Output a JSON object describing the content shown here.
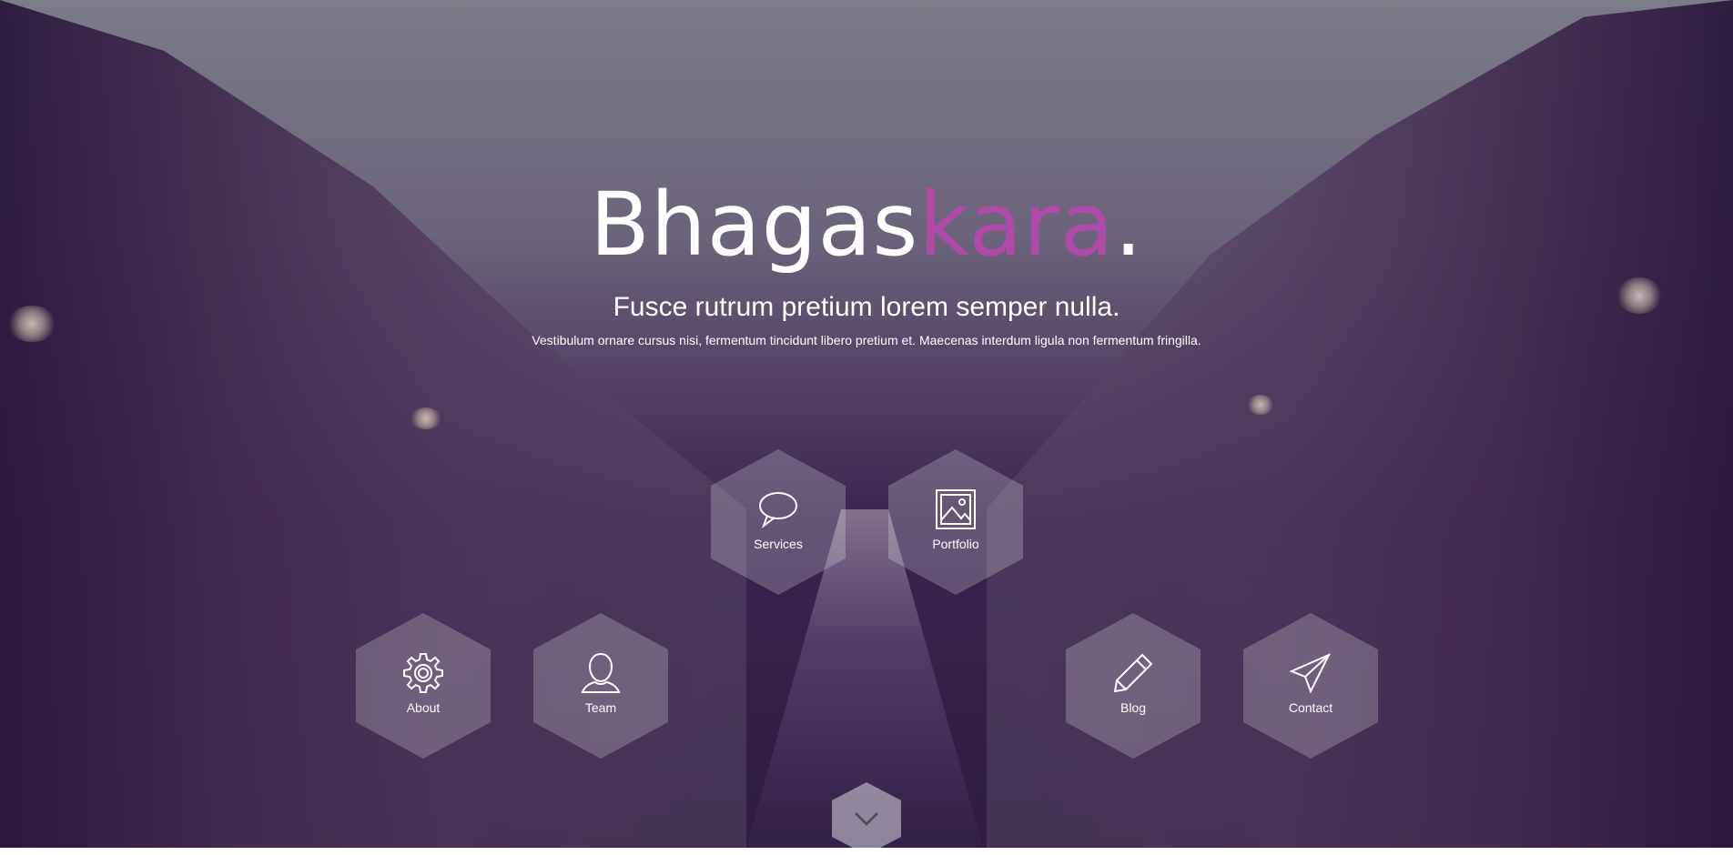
{
  "brand": {
    "logo_main": "Bhagas",
    "logo_accent": "kara",
    "logo_dot": ".",
    "accent_color": "#b04aa8"
  },
  "hero": {
    "subtitle": "Fusce rutrum pretium lorem semper nulla.",
    "tagline": "Vestibulum ornare cursus nisi, fermentum tincidunt libero pretium et. Maecenas interdum ligula non fermentum fringilla."
  },
  "nav": {
    "services": {
      "label": "Services",
      "icon": "speech-bubble-icon"
    },
    "portfolio": {
      "label": "Portfolio",
      "icon": "image-icon"
    },
    "about": {
      "label": "About",
      "icon": "gear-icon"
    },
    "team": {
      "label": "Team",
      "icon": "person-icon"
    },
    "blog": {
      "label": "Blog",
      "icon": "pencil-icon"
    },
    "contact": {
      "label": "Contact",
      "icon": "paper-plane-icon"
    },
    "scroll_down": {
      "icon": "chevron-down-icon"
    }
  }
}
